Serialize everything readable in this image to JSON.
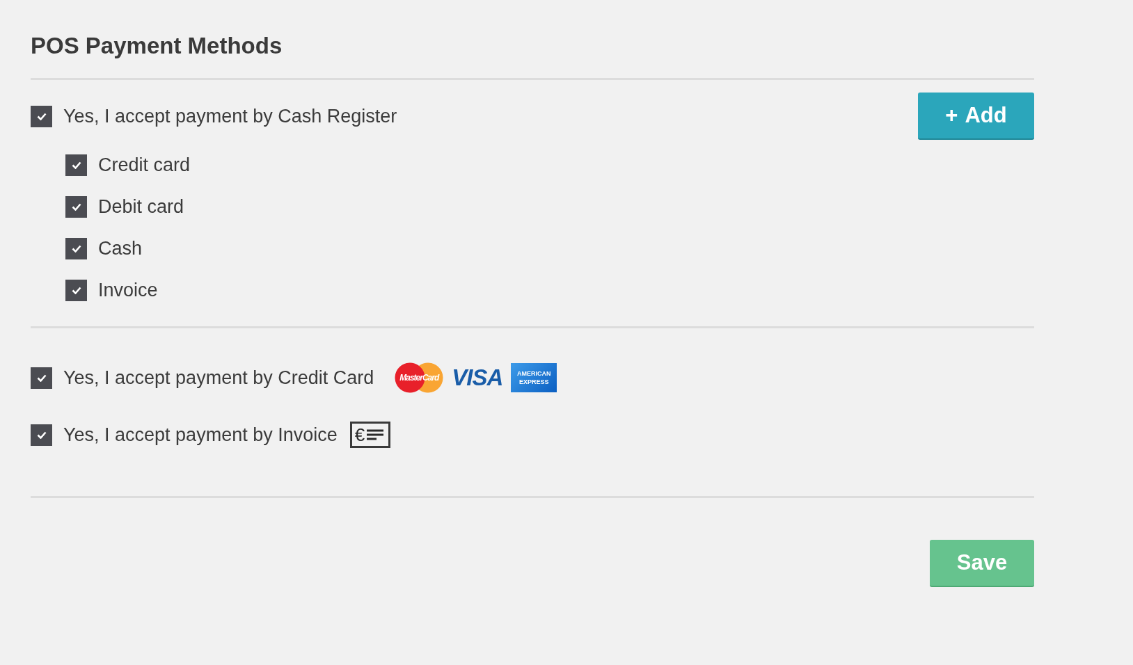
{
  "title": "POS Payment Methods",
  "cash_register": {
    "label": "Yes, I accept payment by Cash Register",
    "checked": true,
    "add_button": {
      "icon": "+",
      "label": "Add"
    },
    "options": [
      {
        "label": "Credit card",
        "checked": true
      },
      {
        "label": "Debit card",
        "checked": true
      },
      {
        "label": "Cash",
        "checked": true
      },
      {
        "label": "Invoice",
        "checked": true
      }
    ]
  },
  "methods": [
    {
      "kind": "cards",
      "label": "Yes, I accept payment by Credit Card",
      "checked": true,
      "logos": [
        {
          "kind": "mastercard",
          "text": "MasterCard"
        },
        {
          "kind": "visa",
          "text": "VISA"
        },
        {
          "kind": "amex",
          "text": "AMERICAN EXPRESS"
        }
      ]
    },
    {
      "kind": "invoice",
      "label": "Yes, I accept payment by Invoice",
      "checked": true,
      "icon_text": "€"
    }
  ],
  "save_button": "Save"
}
